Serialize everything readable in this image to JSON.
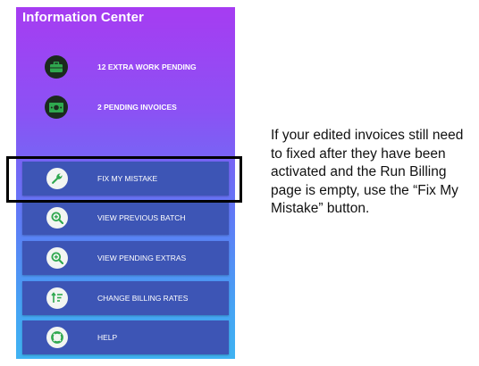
{
  "panel": {
    "title": "Information Center",
    "pending": [
      {
        "label": "12 EXTRA WORK PENDING",
        "icon": "briefcase-icon"
      },
      {
        "label": "2 PENDING INVOICES",
        "icon": "cash-icon"
      }
    ],
    "menu": [
      {
        "label": "FIX MY MISTAKE",
        "icon": "wrench-icon"
      },
      {
        "label": "VIEW PREVIOUS BATCH",
        "icon": "zoom-in-icon"
      },
      {
        "label": "VIEW PENDING EXTRAS",
        "icon": "zoom-in-icon"
      },
      {
        "label": "CHANGE BILLING RATES",
        "icon": "sort-rates-icon"
      },
      {
        "label": "HELP",
        "icon": "lifebuoy-icon"
      }
    ]
  },
  "instructions": {
    "text": "If your edited invoices still need to fixed after they have been activated and the Run Billing page is empty, use the “Fix My Mistake” button."
  },
  "colors": {
    "gradient_top": "#a63cf2",
    "gradient_bottom": "#3fb3f2",
    "button_bg": "#3d55b5",
    "icon_green": "#2fa84f",
    "highlight_border": "#000000"
  }
}
